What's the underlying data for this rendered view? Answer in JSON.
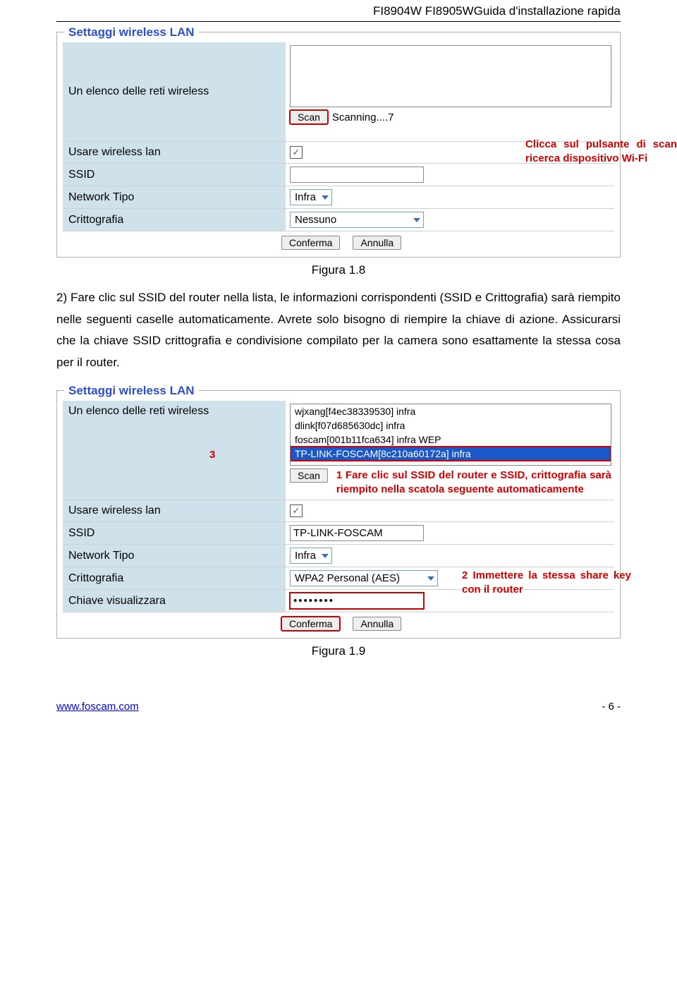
{
  "header": "FI8904W FI8905WGuida d'installazione rapida",
  "panel1": {
    "title": "Settaggi wireless LAN",
    "rows": {
      "wireless_list_label": "Un elenco delle reti wireless",
      "scan_btn": "Scan",
      "scan_status": "Scanning....7",
      "use_wlan_label": "Usare wireless lan",
      "ssid_label": "SSID",
      "network_type_label": "Network Tipo",
      "network_type_value": "Infra",
      "encryption_label": "Crittografia",
      "encryption_value": "Nessuno",
      "confirm_btn": "Conferma",
      "cancel_btn": "Annulla"
    },
    "callout": "Clicca sul pulsante di scansione per la ricerca dispositivo Wi-Fi"
  },
  "fig1_caption": "Figura 1.8",
  "para": "2) Fare clic sul SSID del router nella lista, le informazioni corrispondenti (SSID e Crittografia) sarà riempito nelle seguenti caselle automaticamente. Avrete solo bisogno di riempire la chiave di azione. Assicurarsi che la chiave SSID crittografia e condivisione compilato per la camera sono esattamente la stessa cosa per il router.",
  "panel2": {
    "title": "Settaggi wireless LAN",
    "list_items": [
      "wjxang[f4ec38339530] infra",
      "dlink[f07d685630dc] infra",
      "foscam[001b11fca634] infra WEP",
      "TP-LINK-FOSCAM[8c210a60172a] infra"
    ],
    "rows": {
      "wireless_list_label": "Un elenco delle reti wireless",
      "marker3": "3",
      "scan_btn": "Scan",
      "use_wlan_label": "Usare wireless lan",
      "ssid_label": "SSID",
      "ssid_value": "TP-LINK-FOSCAM",
      "network_type_label": "Network Tipo",
      "network_type_value": "Infra",
      "encryption_label": "Crittografia",
      "encryption_value": "WPA2 Personal (AES)",
      "key_label": "Chiave visualizzara",
      "key_value": "••••••••",
      "confirm_btn": "Conferma",
      "cancel_btn": "Annulla"
    },
    "callout1": "1 Fare clic sul SSID del router e SSID, crittografia sarà riempito nella scatola seguente automaticamente",
    "callout2": "2 Immettere la stessa share key con il router"
  },
  "fig2_caption": "Figura 1.9",
  "footer": {
    "url": "www.foscam.com",
    "page": "- 6 -"
  }
}
